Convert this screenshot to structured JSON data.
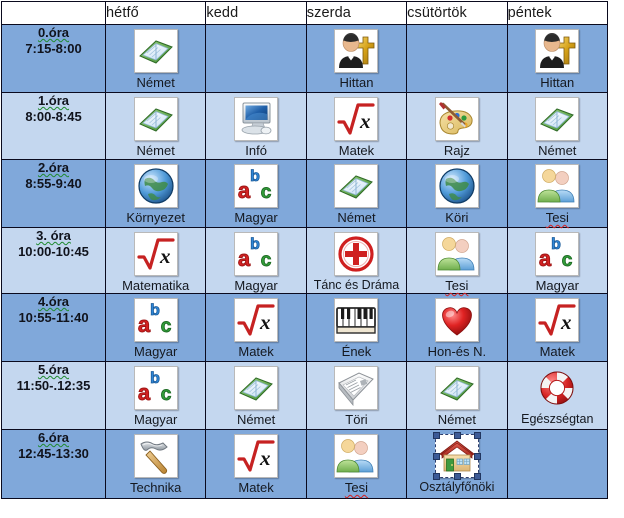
{
  "table": {
    "corner_label": "",
    "days": [
      "hétfő",
      "kedd",
      "szerda",
      "csütörtök",
      "péntek"
    ],
    "rows": [
      {
        "period": "0.óra",
        "time": "7:15-8:00",
        "tint": "dark",
        "lessons": [
          {
            "label": "Német",
            "icon": "book-icon",
            "frame": "plain"
          },
          {
            "label": "",
            "icon": "none",
            "frame": "none"
          },
          {
            "label": "Hittan",
            "icon": "priest-cross-icon",
            "frame": "plain"
          },
          {
            "label": "",
            "icon": "none",
            "frame": "none"
          },
          {
            "label": "Hittan",
            "icon": "priest-cross-icon",
            "frame": "plain"
          }
        ]
      },
      {
        "period": "1.óra",
        "time": "8:00-8:45",
        "tint": "light",
        "lessons": [
          {
            "label": "Német",
            "icon": "book-icon",
            "frame": "plain"
          },
          {
            "label": "Infó",
            "icon": "computer-icon",
            "frame": "plain"
          },
          {
            "label": "Matek",
            "icon": "sqrt-x-icon",
            "frame": "plain"
          },
          {
            "label": "Rajz",
            "icon": "palette-icon",
            "frame": "plain"
          },
          {
            "label": "Német",
            "icon": "book-icon",
            "frame": "plain"
          }
        ]
      },
      {
        "period": "2.óra",
        "time": "8:55-9:40",
        "tint": "dark",
        "lessons": [
          {
            "label": "Környezet",
            "icon": "globe-icon",
            "frame": "plain"
          },
          {
            "label": "Magyar",
            "icon": "abc-icon",
            "frame": "plain"
          },
          {
            "label": "Német",
            "icon": "book-icon",
            "frame": "plain"
          },
          {
            "label": "Köri",
            "icon": "globe-icon",
            "frame": "plain"
          },
          {
            "label": "Tesi",
            "icon": "people-icon",
            "frame": "plain",
            "spellcheck": true
          }
        ]
      },
      {
        "period": "3. óra",
        "time": "10:00-10:45",
        "tint": "light",
        "lessons": [
          {
            "label": "Matematika",
            "icon": "sqrt-x-icon",
            "frame": "plain"
          },
          {
            "label": "Magyar",
            "icon": "abc-icon",
            "frame": "plain"
          },
          {
            "label": "Tánc és Dráma",
            "icon": "red-cross-circle-icon",
            "frame": "plain"
          },
          {
            "label": "Tesi",
            "icon": "people-icon",
            "frame": "plain",
            "spellcheck": true
          },
          {
            "label": "Magyar",
            "icon": "abc-icon",
            "frame": "plain"
          }
        ]
      },
      {
        "period": "4.óra",
        "time": "10:55-11:40",
        "tint": "dark",
        "lessons": [
          {
            "label": "Magyar",
            "icon": "abc-icon",
            "frame": "plain"
          },
          {
            "label": "Matek",
            "icon": "sqrt-x-icon",
            "frame": "plain"
          },
          {
            "label": "Ének",
            "icon": "piano-icon",
            "frame": "plain"
          },
          {
            "label": "Hon-és N.",
            "icon": "heart-icon",
            "frame": "plain"
          },
          {
            "label": "Matek",
            "icon": "sqrt-x-icon",
            "frame": "plain"
          }
        ]
      },
      {
        "period": "5.óra",
        "time": "11:50-.12:35",
        "tint": "light",
        "lessons": [
          {
            "label": "Magyar",
            "icon": "abc-icon",
            "frame": "plain"
          },
          {
            "label": "Német",
            "icon": "book-icon",
            "frame": "plain"
          },
          {
            "label": "Töri",
            "icon": "newspaper-icon",
            "frame": "plain"
          },
          {
            "label": "Német",
            "icon": "book-icon",
            "frame": "plain"
          },
          {
            "label": "Egészségtan",
            "icon": "lifebuoy-icon",
            "frame": "none"
          }
        ]
      },
      {
        "period": "6.óra",
        "time": "12:45-13:30",
        "tint": "dark",
        "lessons": [
          {
            "label": "Technika",
            "icon": "hammer-icon",
            "frame": "plain"
          },
          {
            "label": "Matek",
            "icon": "sqrt-x-icon",
            "frame": "plain"
          },
          {
            "label": "Tesi",
            "icon": "people-icon",
            "frame": "plain",
            "spellcheck": true
          },
          {
            "label": "Osztályfőnöki",
            "icon": "house-icon",
            "frame": "selected"
          },
          {
            "label": "",
            "icon": "none",
            "frame": "none"
          }
        ]
      }
    ]
  },
  "colors": {
    "row_dark": "#80a8da",
    "row_light": "#c4d7ef",
    "border": "#0a0a1e",
    "header_bg": "#ffffff",
    "text": "#14181f",
    "spellcheck_underline": "#d42020",
    "grammar_underline": "#1f8a2e"
  }
}
